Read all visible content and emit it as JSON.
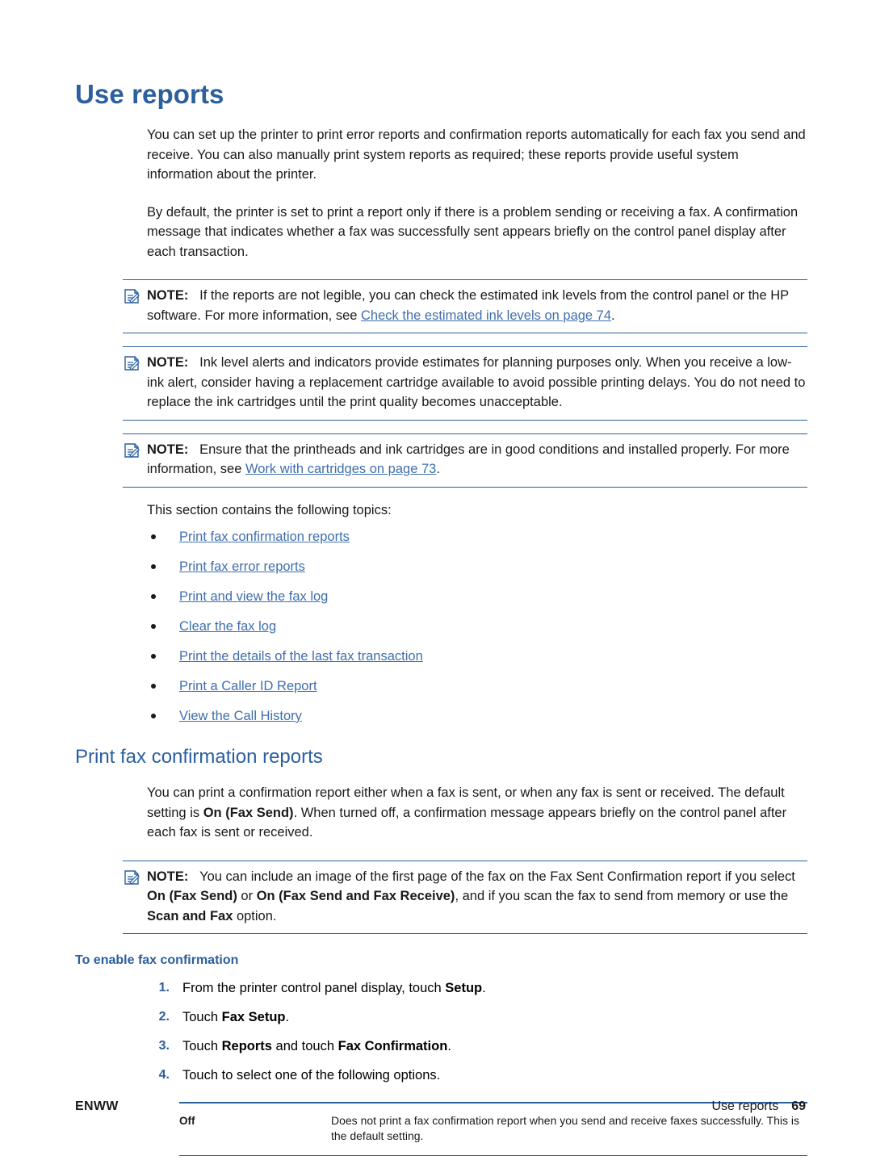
{
  "page": {
    "heading": "Use reports",
    "intro_paragraph_1": "You can set up the printer to print error reports and confirmation reports automatically for each fax you send and receive. You can also manually print system reports as required; these reports provide useful system information about the printer.",
    "intro_paragraph_2": "By default, the printer is set to print a report only if there is a problem sending or receiving a fax. A confirmation message that indicates whether a fax was successfully sent appears briefly on the control panel display after each transaction.",
    "section_intro": "This section contains the following topics:"
  },
  "notes": [
    {
      "label": "NOTE:",
      "text_before": "If the reports are not legible, you can check the estimated ink levels from the control panel or the HP software. For more information, see ",
      "link": "Check the estimated ink levels on page 74",
      "text_after": "."
    },
    {
      "label": "NOTE:",
      "text_before": "Ink level alerts and indicators provide estimates for planning purposes only. When you receive a low-ink alert, consider having a replacement cartridge available to avoid possible printing delays. You do not need to replace the ink cartridges until the print quality becomes unacceptable.",
      "link": "",
      "text_after": ""
    },
    {
      "label": "NOTE:",
      "text_before": "Ensure that the printheads and ink cartridges are in good conditions and installed properly. For more information, see ",
      "link": "Work with cartridges on page 73",
      "text_after": "."
    }
  ],
  "topics": [
    "Print fax confirmation reports",
    "Print fax error reports",
    "Print and view the fax log",
    "Clear the fax log",
    "Print the details of the last fax transaction",
    "Print a Caller ID Report",
    "View the Call History"
  ],
  "subsection": {
    "heading": "Print fax confirmation reports",
    "paragraph_1a": "You can print a confirmation report either when a fax is sent, or when any fax is sent or received. The default setting is ",
    "paragraph_1b": "On (Fax Send)",
    "paragraph_1c": ". When turned off, a confirmation message appears briefly on the control panel after each fax is sent or received.",
    "note": {
      "label": "NOTE:",
      "part1": "You can include an image of the first page of the fax on the Fax Sent Confirmation report if you select ",
      "bold1": "On (Fax Send)",
      "part2": " or ",
      "bold2": "On (Fax Send and Fax Receive)",
      "part3": ", and if you scan the fax to send from memory or use the ",
      "bold3": "Scan and Fax",
      "part4": " option."
    },
    "procedure_title": "To enable fax confirmation",
    "steps": [
      {
        "num": "1.",
        "part1": "From the printer control panel display, touch ",
        "bold1": "Setup",
        "part2": ".",
        "bold2": "",
        "part3": ""
      },
      {
        "num": "2.",
        "part1": "Touch ",
        "bold1": "Fax Setup",
        "part2": ".",
        "bold2": "",
        "part3": ""
      },
      {
        "num": "3.",
        "part1": "Touch ",
        "bold1": "Reports",
        "part2": " and touch ",
        "bold2": "Fax Confirmation",
        "part3": "."
      },
      {
        "num": "4.",
        "part1": "Touch to select one of the following options.",
        "bold1": "",
        "part2": "",
        "bold2": "",
        "part3": ""
      }
    ],
    "options_table": [
      {
        "key": "Off",
        "value": "Does not print a fax confirmation report when you send and receive faxes successfully. This is the default setting."
      }
    ]
  },
  "footer": {
    "left": "ENWW",
    "right_label": "Use reports",
    "page_number": "69"
  },
  "colors": {
    "heading_blue": "#2b5f9e",
    "link_blue": "#3f6fad",
    "rule_blue": "#2b5f9e"
  }
}
